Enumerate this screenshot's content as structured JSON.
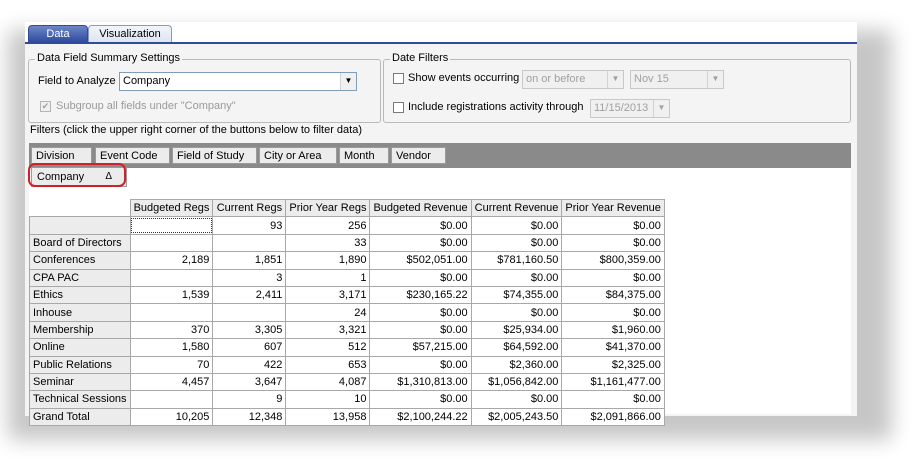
{
  "tabs": [
    {
      "label": "Data",
      "active": true
    },
    {
      "label": "Visualization",
      "active": false
    }
  ],
  "summary": {
    "legend": "Data Field Summary Settings",
    "field_label": "Field to Analyze",
    "field_value": "Company",
    "subgroup_label": "Subgroup all fields under \"Company\"",
    "subgroup_checked": true
  },
  "date_filters": {
    "legend": "Date Filters",
    "show_events_label": "Show events occurring",
    "occurring_value": "on or before",
    "date_value": "Nov 15",
    "include_label": "Include registrations activity through",
    "through_value": "11/15/2013"
  },
  "filters_label": "Filters (click the upper right corner of the buttons below to filter data)",
  "filter_fields": [
    "Division",
    "Event Code",
    "Field of Study",
    "City or Area",
    "Month",
    "Vendor"
  ],
  "row_field": {
    "label": "Company",
    "sort_glyph": "Δ"
  },
  "columns": [
    "Budgeted Regs",
    "Current Regs",
    "Prior Year Regs",
    "Budgeted Revenue",
    "Current Revenue",
    "Prior Year Revenue"
  ],
  "rows": [
    {
      "label": "",
      "values": [
        "",
        "93",
        "256",
        "$0.00",
        "$0.00",
        "$0.00"
      ]
    },
    {
      "label": "Board of Directors",
      "values": [
        "",
        "",
        "33",
        "$0.00",
        "$0.00",
        "$0.00"
      ]
    },
    {
      "label": "Conferences",
      "values": [
        "2,189",
        "1,851",
        "1,890",
        "$502,051.00",
        "$781,160.50",
        "$800,359.00"
      ]
    },
    {
      "label": "CPA PAC",
      "values": [
        "",
        "3",
        "1",
        "$0.00",
        "$0.00",
        "$0.00"
      ]
    },
    {
      "label": "Ethics",
      "values": [
        "1,539",
        "2,411",
        "3,171",
        "$230,165.22",
        "$74,355.00",
        "$84,375.00"
      ]
    },
    {
      "label": "Inhouse",
      "values": [
        "",
        "",
        "24",
        "$0.00",
        "$0.00",
        "$0.00"
      ]
    },
    {
      "label": "Membership",
      "values": [
        "370",
        "3,305",
        "3,321",
        "$0.00",
        "$25,934.00",
        "$1,960.00"
      ]
    },
    {
      "label": "Online",
      "values": [
        "1,580",
        "607",
        "512",
        "$57,215.00",
        "$64,592.00",
        "$41,370.00"
      ]
    },
    {
      "label": "Public Relations",
      "values": [
        "70",
        "422",
        "653",
        "$0.00",
        "$2,360.00",
        "$2,325.00"
      ]
    },
    {
      "label": "Seminar",
      "values": [
        "4,457",
        "3,647",
        "4,087",
        "$1,310,813.00",
        "$1,056,842.00",
        "$1,161,477.00"
      ]
    },
    {
      "label": "Technical Sessions",
      "values": [
        "",
        "9",
        "10",
        "$0.00",
        "$0.00",
        "$0.00"
      ]
    },
    {
      "label": "Grand Total",
      "values": [
        "10,205",
        "12,348",
        "13,958",
        "$2,100,244.22",
        "$2,005,243.50",
        "$2,091,866.00"
      ]
    }
  ]
}
